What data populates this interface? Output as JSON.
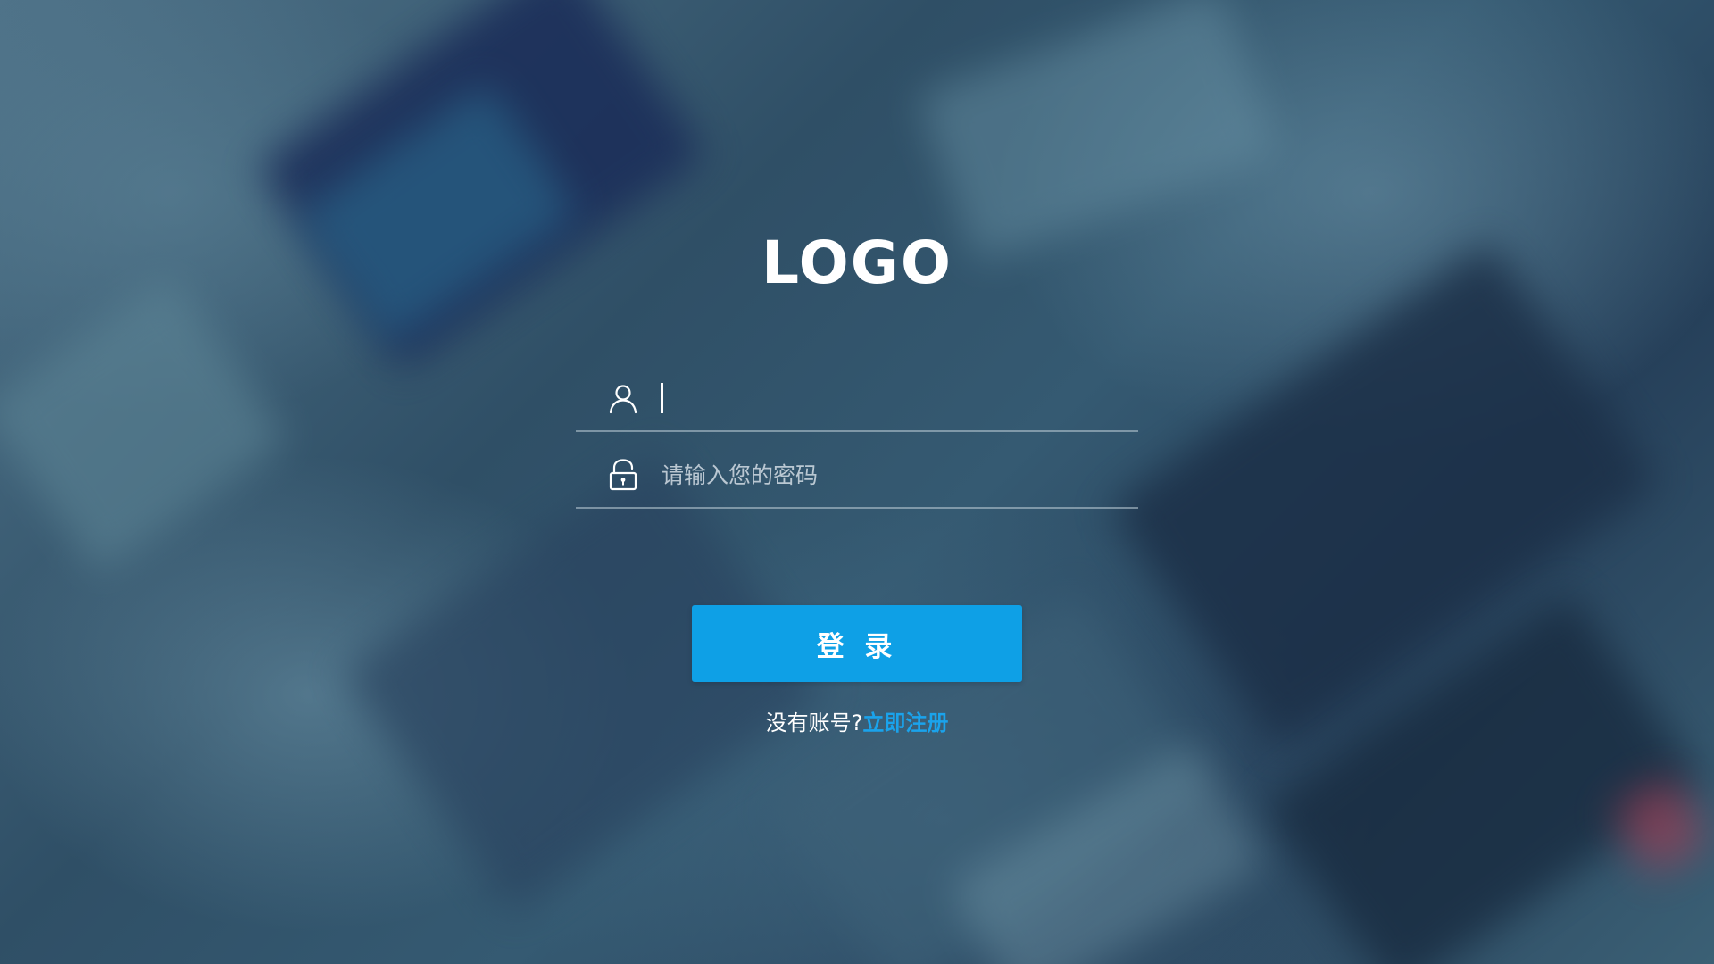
{
  "logo": {
    "text": "LOGO"
  },
  "username": {
    "value": "",
    "placeholder": "",
    "icon": "user-icon"
  },
  "password": {
    "value": "",
    "placeholder": "请输入您的密码",
    "icon": "unlock-icon"
  },
  "login_button": {
    "label": "登 录"
  },
  "register": {
    "prompt": "没有账号?",
    "link_label": "立即注册"
  },
  "colors": {
    "accent": "#0ea0e6",
    "link": "#1aa3ec",
    "text": "#ffffff"
  }
}
